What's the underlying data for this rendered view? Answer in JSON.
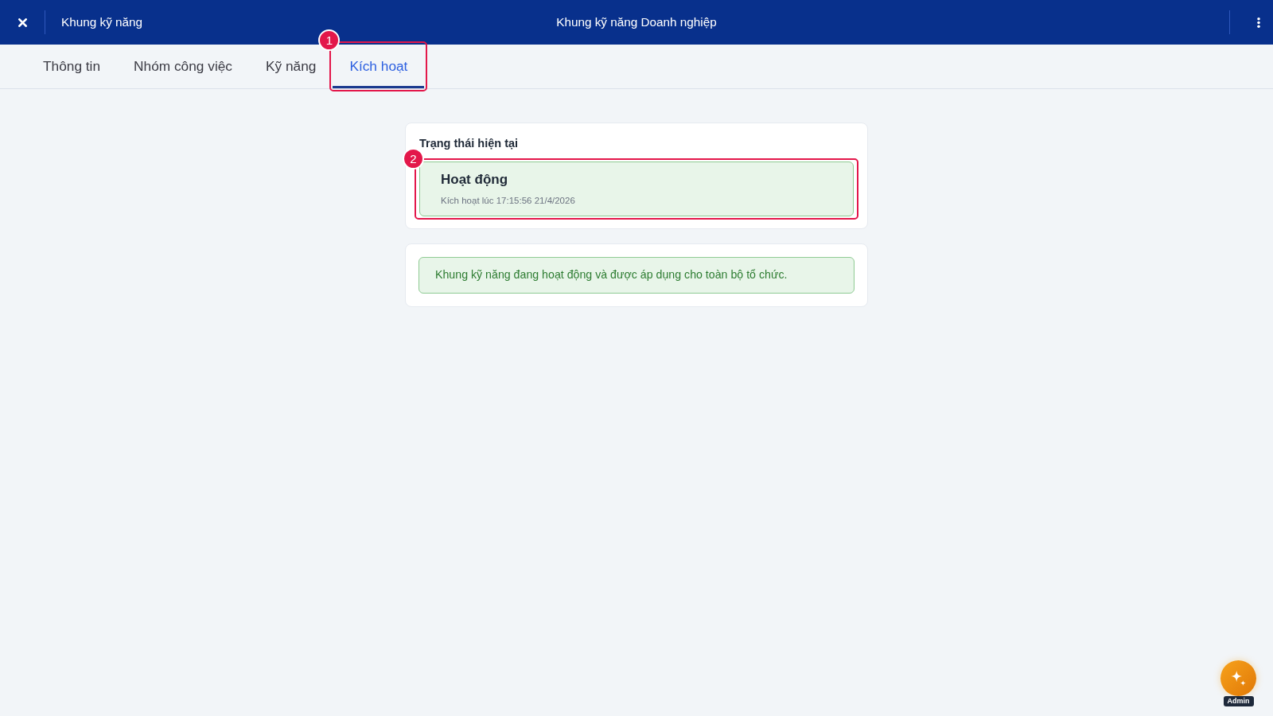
{
  "header": {
    "breadcrumb": "Khung kỹ năng",
    "title": "Khung kỹ năng Doanh nghiệp"
  },
  "tabs": [
    {
      "label": "Thông tin",
      "selected": false
    },
    {
      "label": "Nhóm công việc",
      "selected": false
    },
    {
      "label": "Kỹ năng",
      "selected": false
    },
    {
      "label": "Kích hoạt",
      "selected": true,
      "callout": "1"
    }
  ],
  "status_card": {
    "heading": "Trạng thái hiện tại",
    "status": {
      "label": "Hoạt động",
      "detail": "Kích hoạt lúc 17:15:56 21/4/2026",
      "callout": "2"
    }
  },
  "notice": {
    "text": "Khung kỹ năng đang hoạt động và được áp dụng cho toàn bộ tổ chức."
  },
  "assistant_button": {
    "tag": "Admin"
  }
}
